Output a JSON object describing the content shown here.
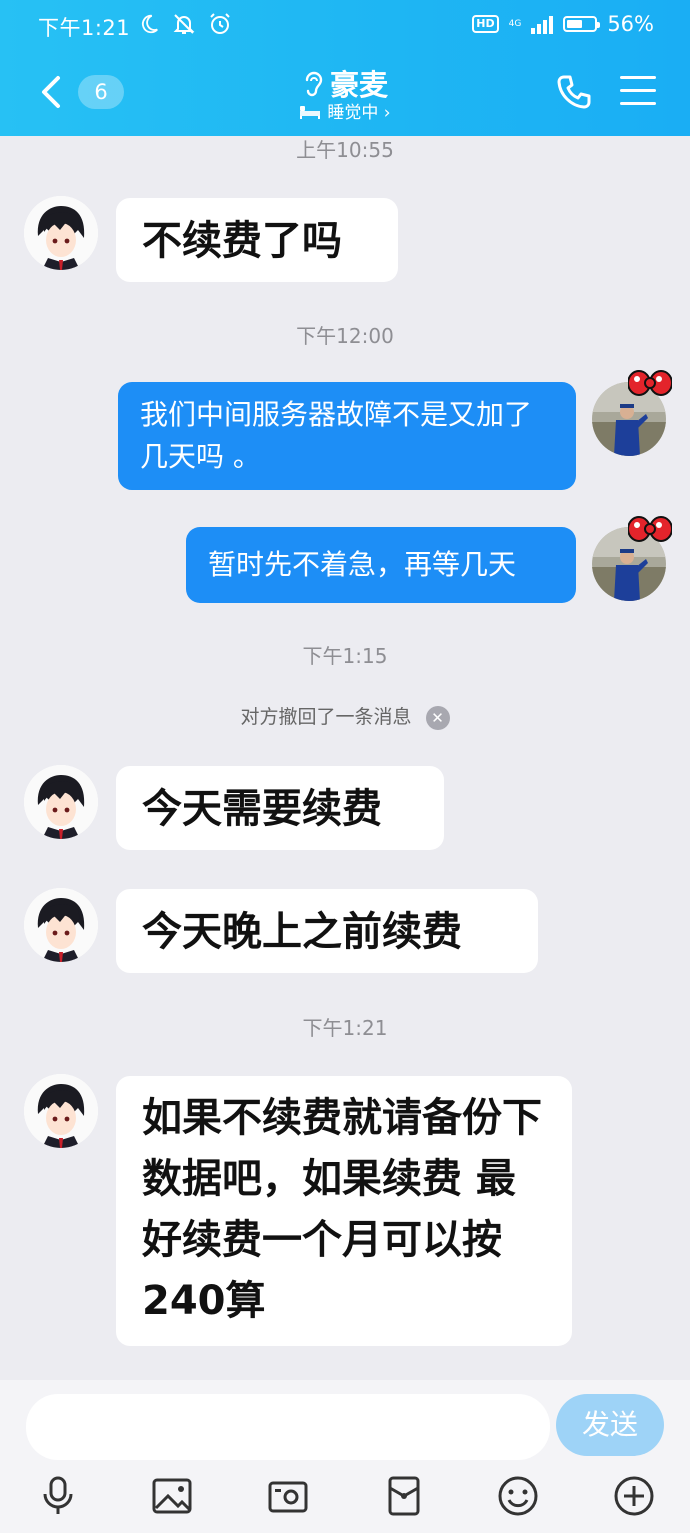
{
  "status_bar": {
    "time": "下午1:21",
    "network": "4G",
    "hd": "HD",
    "battery": "56%",
    "battery_level": 0.56
  },
  "header": {
    "unread_count": "6",
    "contact_name": "豪麦",
    "contact_status": "睡觉中 ›"
  },
  "messages": {
    "ts1": "上午10:55",
    "m1": "不续费了吗",
    "ts2": "下午12:00",
    "m2": "我们中间服务器故障不是又加了几天吗 。",
    "m3": "暂时先不着急，再等几天",
    "ts3": "下午1:15",
    "recall_notice": "对方撤回了一条消息",
    "m4": "今天需要续费",
    "m5": "今天晚上之前续费",
    "ts4": "下午1:21",
    "m6": "如果不续费就请备份下数据吧，如果续费 最好续费一个月可以按240算"
  },
  "composer": {
    "placeholder": "",
    "send_label": "发送"
  },
  "toolbar": [
    "mic-icon",
    "image-icon",
    "camera-icon",
    "red-packet-icon",
    "emoji-icon",
    "plus-icon"
  ],
  "colors": {
    "header": "#1fb7f3",
    "outgoing_bubble": "#1d8ef6",
    "send_button": "#9ed3f7"
  }
}
